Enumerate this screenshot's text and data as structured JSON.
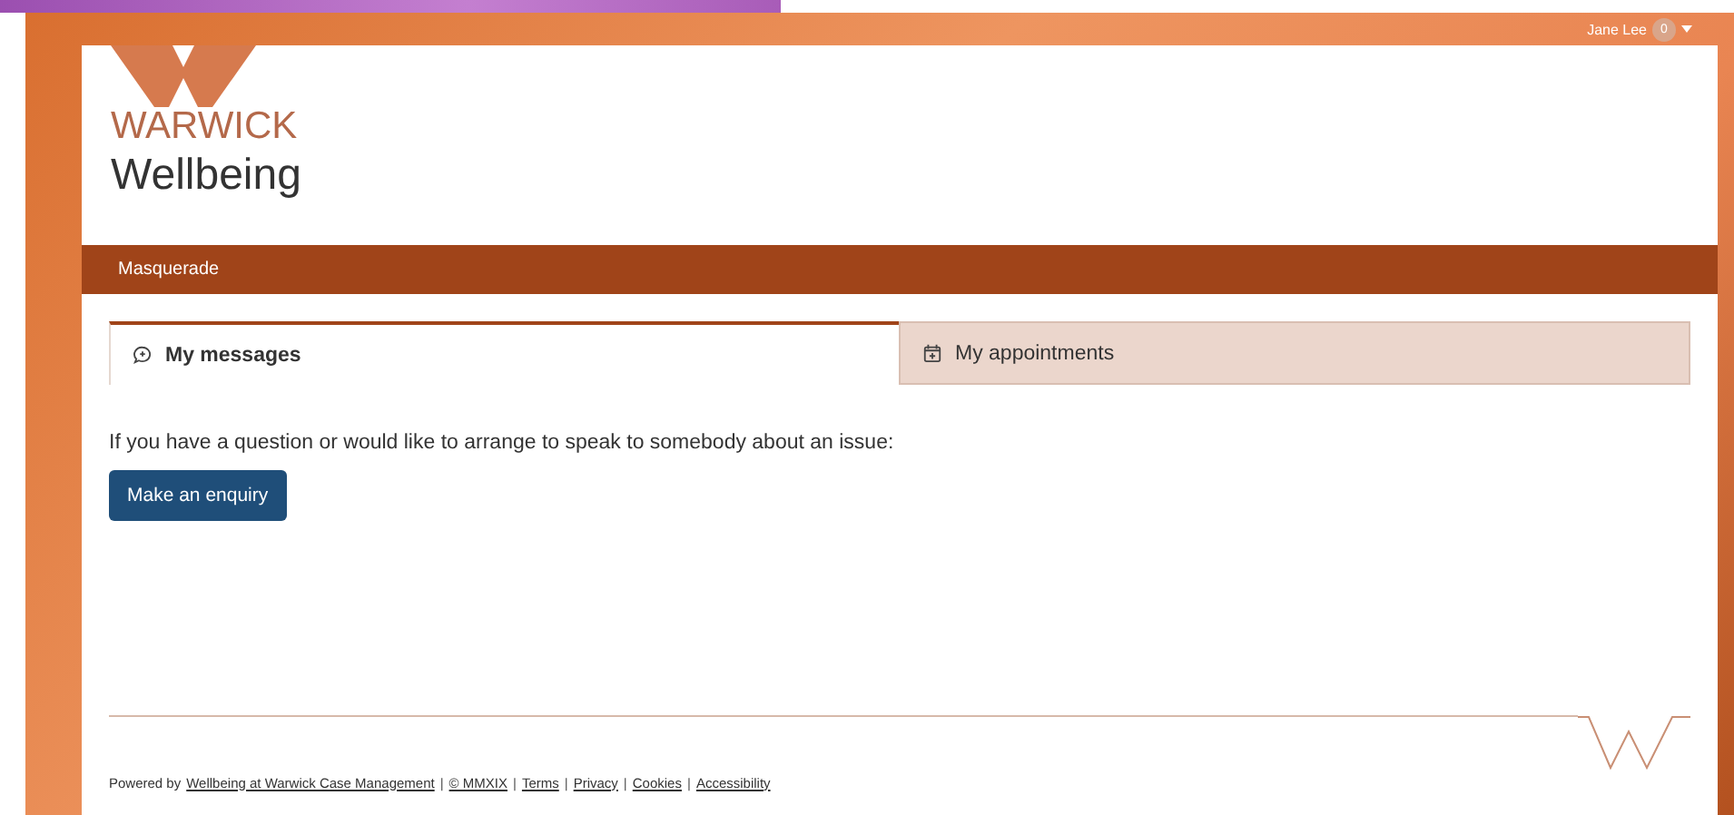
{
  "user_menu": {
    "name": "Jane Lee",
    "badge": "0"
  },
  "brand": {
    "logo_text": "WARWICK",
    "title": "Wellbeing"
  },
  "nav": {
    "items": [
      {
        "label": "Masquerade"
      }
    ]
  },
  "tabs": [
    {
      "label": "My messages",
      "kind": "chat",
      "selected": true
    },
    {
      "label": "My appointments",
      "kind": "calendar",
      "selected": false
    }
  ],
  "content": {
    "intro": "If you have a question or would like to arrange to speak to somebody about an issue:",
    "button": "Make an enquiry"
  },
  "footer": [
    {
      "kind": "text",
      "text": "Powered by"
    },
    {
      "kind": "link",
      "text": "Wellbeing at Warwick Case Management"
    },
    {
      "kind": "separator",
      "text": "|"
    },
    {
      "kind": "link",
      "text": "© MMXIX"
    },
    {
      "kind": "separator",
      "text": "|"
    },
    {
      "kind": "link",
      "text": "Terms"
    },
    {
      "kind": "separator",
      "text": "|"
    },
    {
      "kind": "link",
      "text": "Privacy"
    },
    {
      "kind": "separator",
      "text": "|"
    },
    {
      "kind": "link",
      "text": "Cookies"
    },
    {
      "kind": "separator",
      "text": "|"
    },
    {
      "kind": "link",
      "text": "Accessibility"
    }
  ]
}
